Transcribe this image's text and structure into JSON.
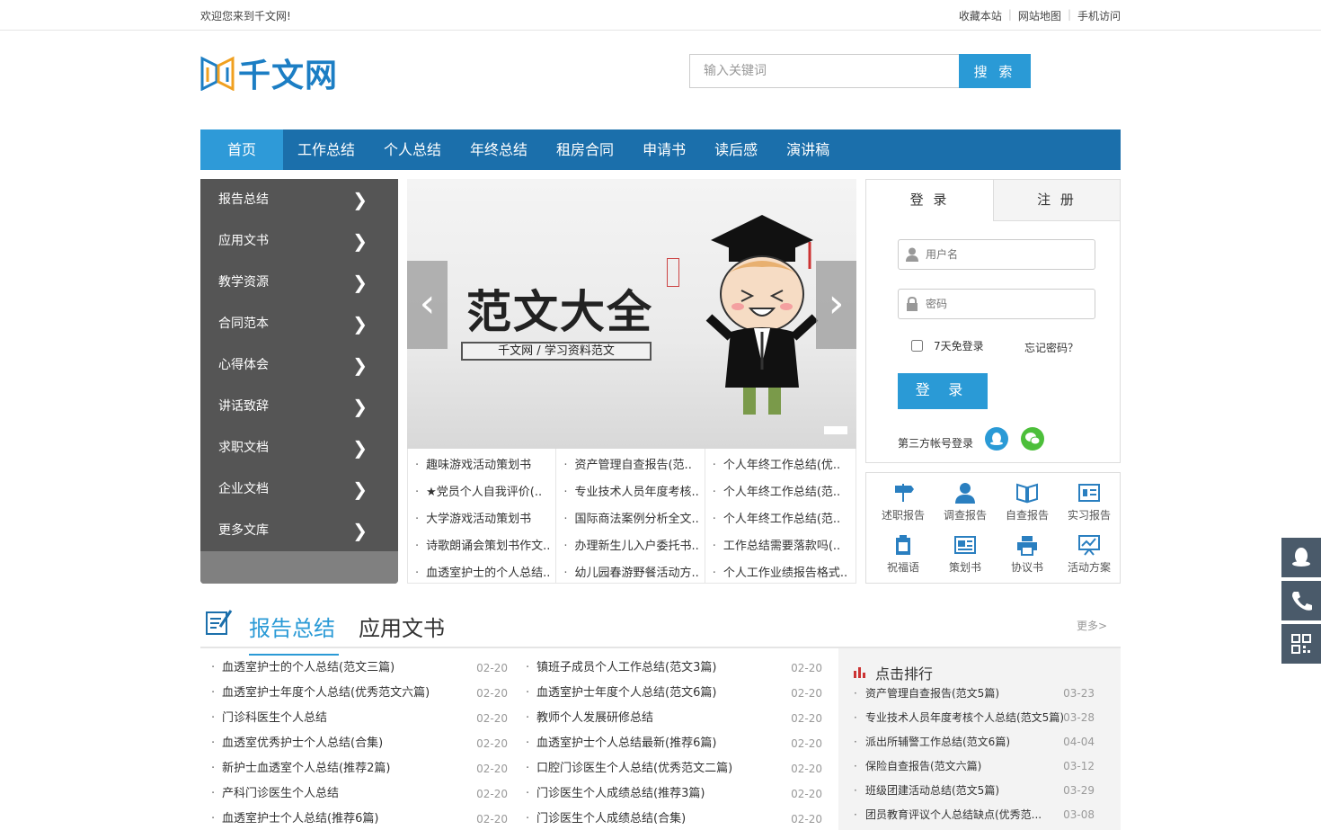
{
  "topbar": {
    "welcome": "欢迎您来到千文网!",
    "links": [
      "收藏本站",
      "网站地图",
      "手机访问"
    ]
  },
  "header": {
    "logo_text": "千文网",
    "search_placeholder": "输入关键词",
    "search_button": "搜 索"
  },
  "nav": [
    "首页",
    "工作总结",
    "个人总结",
    "年终总结",
    "租房合同",
    "申请书",
    "读后感",
    "演讲稿"
  ],
  "categories": [
    "报告总结",
    "应用文书",
    "教学资源",
    "合同范本",
    "心得体会",
    "讲话致辞",
    "求职文档",
    "企业文档",
    "更多文库"
  ],
  "banner": {
    "title": "范文大全",
    "subtitle": "千文网 / 学习资料范文"
  },
  "articles": [
    [
      "趣味游戏活动策划书",
      "★党员个人自我评价(..",
      "大学游戏活动策划书",
      "诗歌朗诵会策划书作文..",
      "血透室护士的个人总结.."
    ],
    [
      "资产管理自查报告(范..",
      "专业技术人员年度考核..",
      "国际商法案例分析全文..",
      "办理新生儿入户委托书..",
      "幼儿园春游野餐活动方.."
    ],
    [
      "个人年终工作总结(优..",
      "个人年终工作总结(范..",
      "个人年终工作总结(范..",
      "工作总结需要落款吗(..",
      "个人工作业绩报告格式.."
    ]
  ],
  "login": {
    "tab_login": "登 录",
    "tab_register": "注 册",
    "username_placeholder": "用户名",
    "password_placeholder": "密码",
    "remember": "7天免登录",
    "forgot": "忘记密码？",
    "login_button": "登 录",
    "third_party": "第三方帐号登录"
  },
  "quick_links": [
    "述职报告",
    "调查报告",
    "自查报告",
    "实习报告",
    "祝福语",
    "策划书",
    "协议书",
    "活动方案"
  ],
  "section": {
    "tab_active": "报告总结",
    "tab_other": "应用文书",
    "more": "更多>",
    "left_list": [
      {
        "title": "血透室护士的个人总结(范文三篇)",
        "date": "02-20"
      },
      {
        "title": "血透室护士年度个人总结(优秀范文六篇)",
        "date": "02-20"
      },
      {
        "title": "门诊科医生个人总结",
        "date": "02-20"
      },
      {
        "title": "血透室优秀护士个人总结(合集)",
        "date": "02-20"
      },
      {
        "title": "新护士血透室个人总结(推荐2篇)",
        "date": "02-20"
      },
      {
        "title": "产科门诊医生个人总结",
        "date": "02-20"
      },
      {
        "title": "血透室护士个人总结(推荐6篇)",
        "date": "02-20"
      }
    ],
    "right_list": [
      {
        "title": "镇班子成员个人工作总结(范文3篇)",
        "date": "02-20"
      },
      {
        "title": "血透室护士年度个人总结(范文6篇)",
        "date": "02-20"
      },
      {
        "title": "教师个人发展研修总结",
        "date": "02-20"
      },
      {
        "title": "血透室护士个人总结最新(推荐6篇)",
        "date": "02-20"
      },
      {
        "title": "口腔门诊医生个人总结(优秀范文二篇)",
        "date": "02-20"
      },
      {
        "title": "门诊医生个人成绩总结(推荐3篇)",
        "date": "02-20"
      },
      {
        "title": "门诊医生个人成绩总结(合集)",
        "date": "02-20"
      }
    ]
  },
  "ranking": {
    "title": "点击排行",
    "items": [
      {
        "title": "资产管理自查报告(范文5篇)",
        "date": "03-23"
      },
      {
        "title": "专业技术人员年度考核个人总结(范文5篇)",
        "date": "03-28"
      },
      {
        "title": "派出所辅警工作总结(范文6篇)",
        "date": "04-04"
      },
      {
        "title": "保险自查报告(范文六篇)",
        "date": "03-12"
      },
      {
        "title": "班级团建活动总结(范文5篇)",
        "date": "03-29"
      },
      {
        "title": "团员教育评议个人总结缺点(优秀范...",
        "date": "03-08"
      }
    ]
  },
  "colors": {
    "accent": "#2a9ad6",
    "nav": "#1b6fab",
    "sidebar": "#555555"
  }
}
